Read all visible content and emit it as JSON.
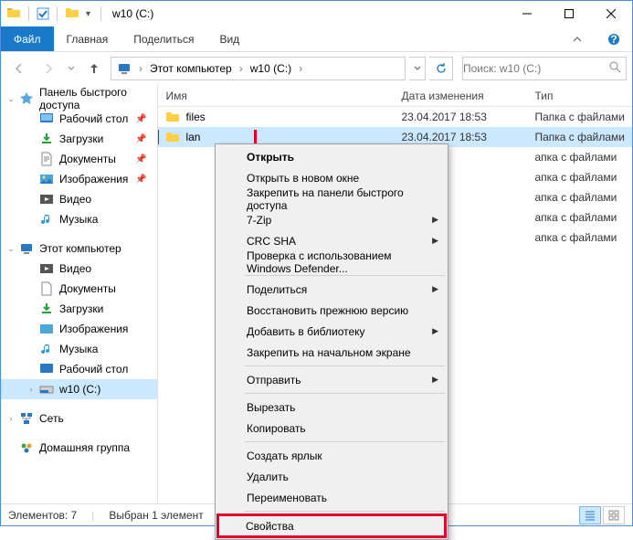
{
  "title": "w10 (C:)",
  "ribbon": {
    "file": "Файл",
    "home": "Главная",
    "share": "Поделиться",
    "view": "Вид"
  },
  "breadcrumb": {
    "pc": "Этот компьютер",
    "drive": "w10 (C:)"
  },
  "search_placeholder": "Поиск: w10 (C:)",
  "nav": {
    "quick": "Панель быстрого доступа",
    "desktop": "Рабочий стол",
    "downloads": "Загрузки",
    "documents": "Документы",
    "pictures": "Изображения",
    "videos": "Видео",
    "music": "Музыка",
    "thispc": "Этот компьютер",
    "tp_videos": "Видео",
    "tp_documents": "Документы",
    "tp_downloads": "Загрузки",
    "tp_pictures": "Изображения",
    "tp_music": "Музыка",
    "tp_desktop": "Рабочий стол",
    "tp_drive": "w10 (C:)",
    "network": "Сеть",
    "homegroup": "Домашняя группа"
  },
  "columns": {
    "name": "Имя",
    "date": "Дата изменения",
    "type": "Тип"
  },
  "files": [
    {
      "name": "files",
      "date": "23.04.2017 18:53",
      "type": "Папка с файлами"
    },
    {
      "name": "lan",
      "date": "23.04.2017 18:53",
      "type": "Папка с файлами"
    },
    {
      "name": "",
      "date": "",
      "type": "апка с файлами"
    },
    {
      "name": "",
      "date": "",
      "type": "апка с файлами"
    },
    {
      "name": "",
      "date": "",
      "type": "апка с файлами"
    },
    {
      "name": "",
      "date": "",
      "type": "апка с файлами"
    },
    {
      "name": "",
      "date": "",
      "type": "апка с файлами"
    }
  ],
  "ctx": {
    "open": "Открыть",
    "open_new": "Открыть в новом окне",
    "pin_quick": "Закрепить на панели быстрого доступа",
    "sevenzip": "7-Zip",
    "crcsha": "CRC SHA",
    "defender": "Проверка с использованием Windows Defender...",
    "share": "Поделиться",
    "restore": "Восстановить прежнюю версию",
    "library": "Добавить в библиотеку",
    "pin_start": "Закрепить на начальном экране",
    "send_to": "Отправить",
    "cut": "Вырезать",
    "copy": "Копировать",
    "shortcut": "Создать ярлык",
    "delete": "Удалить",
    "rename": "Переименовать",
    "properties": "Свойства"
  },
  "status": {
    "count": "Элементов: 7",
    "selected": "Выбран 1 элемент"
  }
}
